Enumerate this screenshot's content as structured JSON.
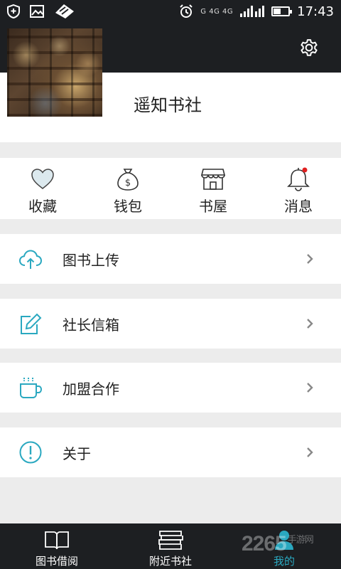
{
  "status_bar": {
    "network": "G 4G 4G",
    "battery_level": 0.5,
    "time": "17:43"
  },
  "profile": {
    "shop_name": "遥知书社"
  },
  "quick_menu": [
    {
      "label": "收藏",
      "icon": "heart-icon"
    },
    {
      "label": "钱包",
      "icon": "money-bag-icon"
    },
    {
      "label": "书屋",
      "icon": "store-icon"
    },
    {
      "label": "消息",
      "icon": "bell-icon"
    }
  ],
  "menu": [
    {
      "label": "图书上传",
      "icon": "cloud-upload-icon"
    },
    {
      "label": "社长信箱",
      "icon": "edit-icon"
    },
    {
      "label": "加盟合作",
      "icon": "coffee-cup-icon"
    },
    {
      "label": "关于",
      "icon": "info-icon"
    }
  ],
  "bottom_nav": [
    {
      "label": "图书借阅",
      "icon": "open-book-icon",
      "active": false
    },
    {
      "label": "附近书社",
      "icon": "book-stack-icon",
      "active": false
    },
    {
      "label": "我的",
      "icon": "user-icon",
      "active": true
    }
  ],
  "watermark": {
    "text": "2265",
    "sub": "手游网"
  },
  "colors": {
    "accent": "#2aa8c0",
    "dark_bar": "#1d1f22",
    "background": "#ececec",
    "notification_dot": "#e02020"
  }
}
